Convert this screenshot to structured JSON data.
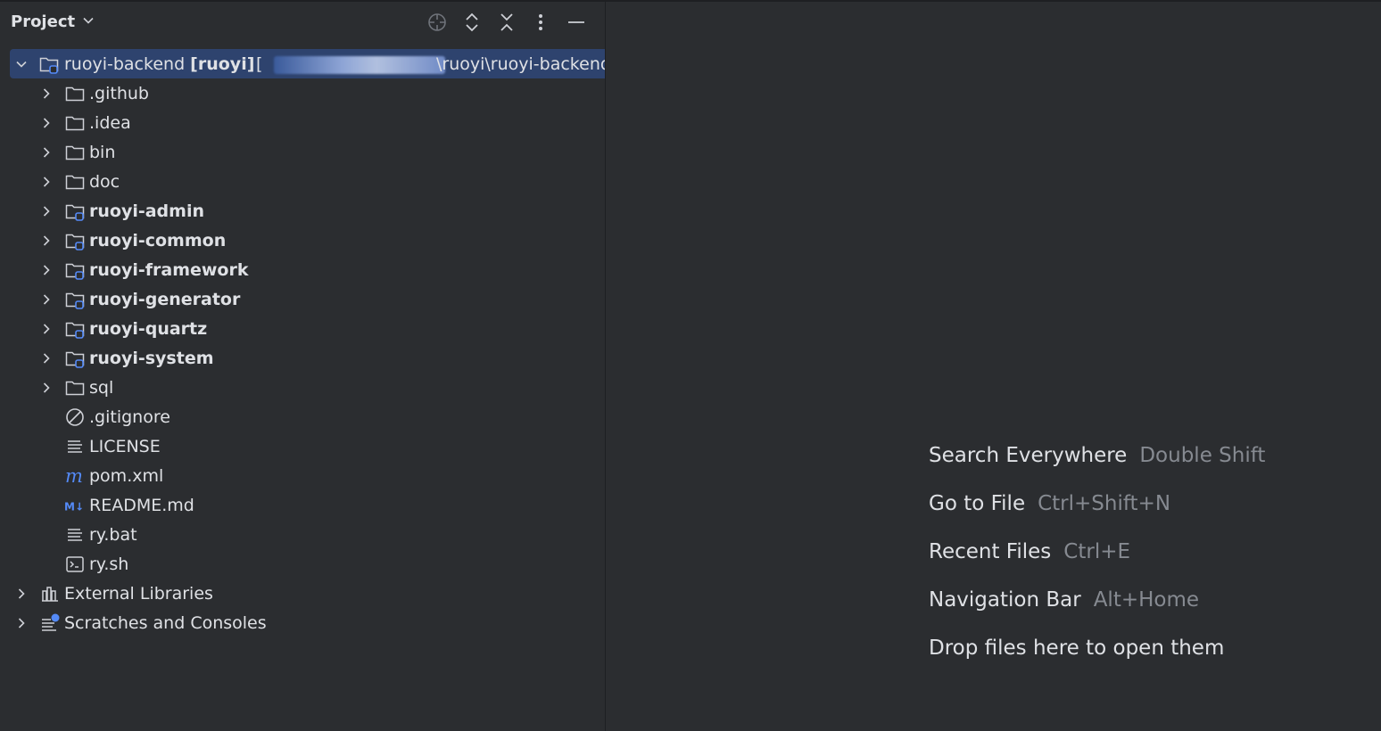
{
  "pane": {
    "title": "Project"
  },
  "tree": {
    "root": {
      "name": "ruoyi-backend",
      "module": "[ruoyi]",
      "path_prefix": "[",
      "path_suffix": "\\ruoyi\\ruoyi-backend"
    },
    "items": [
      {
        "label": ".github"
      },
      {
        "label": ".idea"
      },
      {
        "label": "bin"
      },
      {
        "label": "doc"
      },
      {
        "label": "ruoyi-admin"
      },
      {
        "label": "ruoyi-common"
      },
      {
        "label": "ruoyi-framework"
      },
      {
        "label": "ruoyi-generator"
      },
      {
        "label": "ruoyi-quartz"
      },
      {
        "label": "ruoyi-system"
      },
      {
        "label": "sql"
      },
      {
        "label": ".gitignore"
      },
      {
        "label": "LICENSE"
      },
      {
        "label": "pom.xml"
      },
      {
        "label": "README.md"
      },
      {
        "label": "ry.bat"
      },
      {
        "label": "ry.sh"
      }
    ],
    "external_libraries": "External Libraries",
    "scratches": "Scratches and Consoles"
  },
  "editor": {
    "hints": [
      {
        "action": "Search Everywhere",
        "shortcut": "Double Shift"
      },
      {
        "action": "Go to File",
        "shortcut": "Ctrl+Shift+N"
      },
      {
        "action": "Recent Files",
        "shortcut": "Ctrl+E"
      },
      {
        "action": "Navigation Bar",
        "shortcut": "Alt+Home"
      },
      {
        "action": "Drop files here to open them",
        "shortcut": ""
      }
    ]
  },
  "colors": {
    "background": "#2b2d30",
    "selection": "#2e436e",
    "module_badge": "#548af7",
    "muted_text": "#868a91"
  }
}
